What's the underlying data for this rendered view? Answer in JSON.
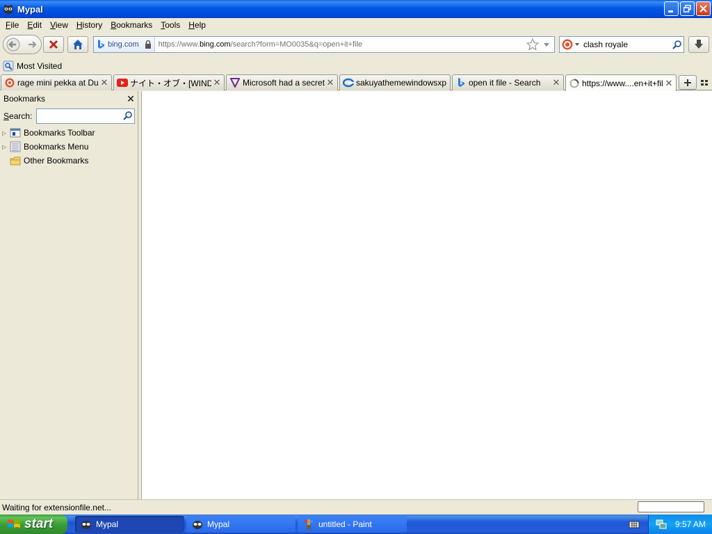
{
  "window": {
    "title": "Mypal"
  },
  "menu": [
    {
      "label": "File",
      "access": "F",
      "rest": "ile"
    },
    {
      "label": "Edit",
      "access": "E",
      "rest": "dit"
    },
    {
      "label": "View",
      "access": "V",
      "rest": "iew"
    },
    {
      "label": "History",
      "access": "H",
      "rest": "istory"
    },
    {
      "label": "Bookmarks",
      "access": "B",
      "rest": "ookmarks"
    },
    {
      "label": "Tools",
      "access": "T",
      "rest": "ools"
    },
    {
      "label": "Help",
      "access": "H",
      "rest": "elp"
    }
  ],
  "navigation": {
    "identity_domain": "bing.com",
    "url_prefix": "https://www.",
    "url_host": "bing.com",
    "url_path": "/search?form=MO0035&q=open+it+file",
    "search_query": "clash royale"
  },
  "bookmarks_toolbar": {
    "most_visited": "Most Visited"
  },
  "tabs": [
    {
      "label": "rage mini pekka at Duc...",
      "icon": "duckduckgo-icon",
      "active": false
    },
    {
      "label": "ナイト・オブ・[WINDO...",
      "icon": "youtube-icon",
      "active": false
    },
    {
      "label": "Microsoft had a secret...",
      "icon": "verge-icon",
      "active": false
    },
    {
      "label": "sakuyathemewindowsxp",
      "icon": "edge-icon",
      "active": false
    },
    {
      "label": "open it file - Search",
      "icon": "bing-icon",
      "active": false
    },
    {
      "label": "https://www....en+it+file",
      "icon": "loading-icon",
      "active": true
    }
  ],
  "sidebar": {
    "title": "Bookmarks",
    "search_label": "Search:",
    "search_access": "S",
    "search_rest": "earch:",
    "items": [
      {
        "label": "Bookmarks Toolbar",
        "icon": "bookmarks-toolbar-icon",
        "expandable": true
      },
      {
        "label": "Bookmarks Menu",
        "icon": "bookmarks-menu-icon",
        "expandable": true
      },
      {
        "label": "Other Bookmarks",
        "icon": "other-bookmarks-folder-icon",
        "expandable": false
      }
    ]
  },
  "status": {
    "text": "Waiting for extensionfile.net..."
  },
  "taskbar": {
    "start_label": "start",
    "tasks": [
      {
        "label": "Mypal",
        "icon": "mypal-icon",
        "active": true
      },
      {
        "label": "Mypal",
        "icon": "mypal-icon",
        "active": false
      },
      {
        "label": "untitled - Paint",
        "icon": "paint-icon",
        "active": false
      }
    ],
    "clock": "9:57 AM"
  }
}
